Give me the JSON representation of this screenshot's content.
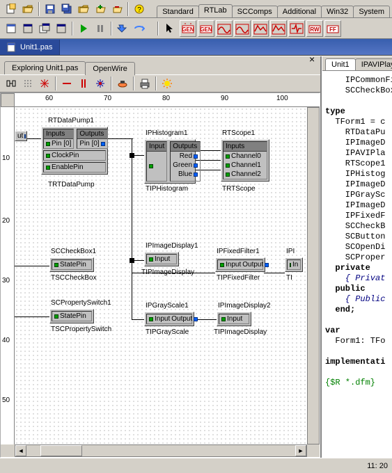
{
  "palette_tabs": [
    "Standard",
    "RTLab",
    "SCComps",
    "Additional",
    "Win32",
    "System"
  ],
  "palette_active": 1,
  "file_tab": "Unit1.pas",
  "designer_tabs": [
    "Exploring Unit1.pas",
    "OpenWire"
  ],
  "designer_active": 1,
  "code_tabs": [
    "Unit1",
    "IPAVIPlayer"
  ],
  "code_active": 0,
  "ruler_h": [
    "60",
    "70",
    "80",
    "90",
    "100"
  ],
  "ruler_v": [
    "10",
    "20",
    "30",
    "40",
    "50"
  ],
  "components": {
    "rtdatapump": {
      "name": "RTDataPump1",
      "type": "TRTDataPump",
      "inputs_hdr": "Inputs",
      "outputs_hdr": "Outputs",
      "pin_in": "Pin [0]",
      "pin_out": "Pin [0]",
      "clock": "ClockPin",
      "enable": "EnablePin"
    },
    "iphist": {
      "name": "IPHistogram1",
      "type": "TIPHistogram",
      "in_hdr": "Input",
      "out_hdr": "Outputs",
      "r": "Red",
      "g": "Green",
      "b": "Blue"
    },
    "rtscope": {
      "name": "RTScope1",
      "type": "TRTScope",
      "in_hdr": "Inputs",
      "c0": "Channel0",
      "c1": "Channel1",
      "c2": "Channel2"
    },
    "sccheck": {
      "name": "SCCheckBox1",
      "type": "TSCCheckBox",
      "state": "StatePin"
    },
    "scprop": {
      "name": "SCPropertySwitch1",
      "type": "TSCPropertySwitch",
      "state": "StatePin"
    },
    "ipimgdisp1": {
      "name": "IPImageDisplay1",
      "type": "TIPImageDisplay",
      "in": "Input"
    },
    "ipfixed": {
      "name": "IPFixedFilter1",
      "type": "TIPFixedFilter",
      "in": "Input",
      "out": "Output"
    },
    "ipi": {
      "name": "IPI",
      "in": "In"
    },
    "ipgray": {
      "name": "IPGrayScale1",
      "type": "TIPGrayScale",
      "in": "Input",
      "out": "Output"
    },
    "ipimgdisp2": {
      "name": "IPImageDisplay2",
      "type": "TIPImageDisplay",
      "in": "Input"
    },
    "leftcut": {
      "out": "ut"
    }
  },
  "code": {
    "l1": "    IPCommonFi",
    "l2": "    SCCheckBox",
    "l3": "",
    "l4": "type",
    "l5": "  TForm1 = c",
    "l6": "    RTDataPu",
    "l7": "    IPImageD",
    "l8": "    IPAVIPla",
    "l9": "    RTScope1",
    "l10": "    IPHistog",
    "l11": "    IPImageD",
    "l12": "    IPGraySc",
    "l13": "    IPImageD",
    "l14": "    IPFixedF",
    "l15": "    SCCheckB",
    "l16": "    SCButton",
    "l17": "    SCOpenDi",
    "l18": "    SCProper",
    "l19": "  private",
    "l20": "    { Privat",
    "l21": "  public",
    "l22": "    { Public",
    "l23": "  end;",
    "l24": "",
    "l25": "var",
    "l26": "  Form1: TFo",
    "l27": "",
    "l28": "implementati",
    "l29": "",
    "l30": "{$R *.dfm}"
  },
  "status": "11: 20"
}
